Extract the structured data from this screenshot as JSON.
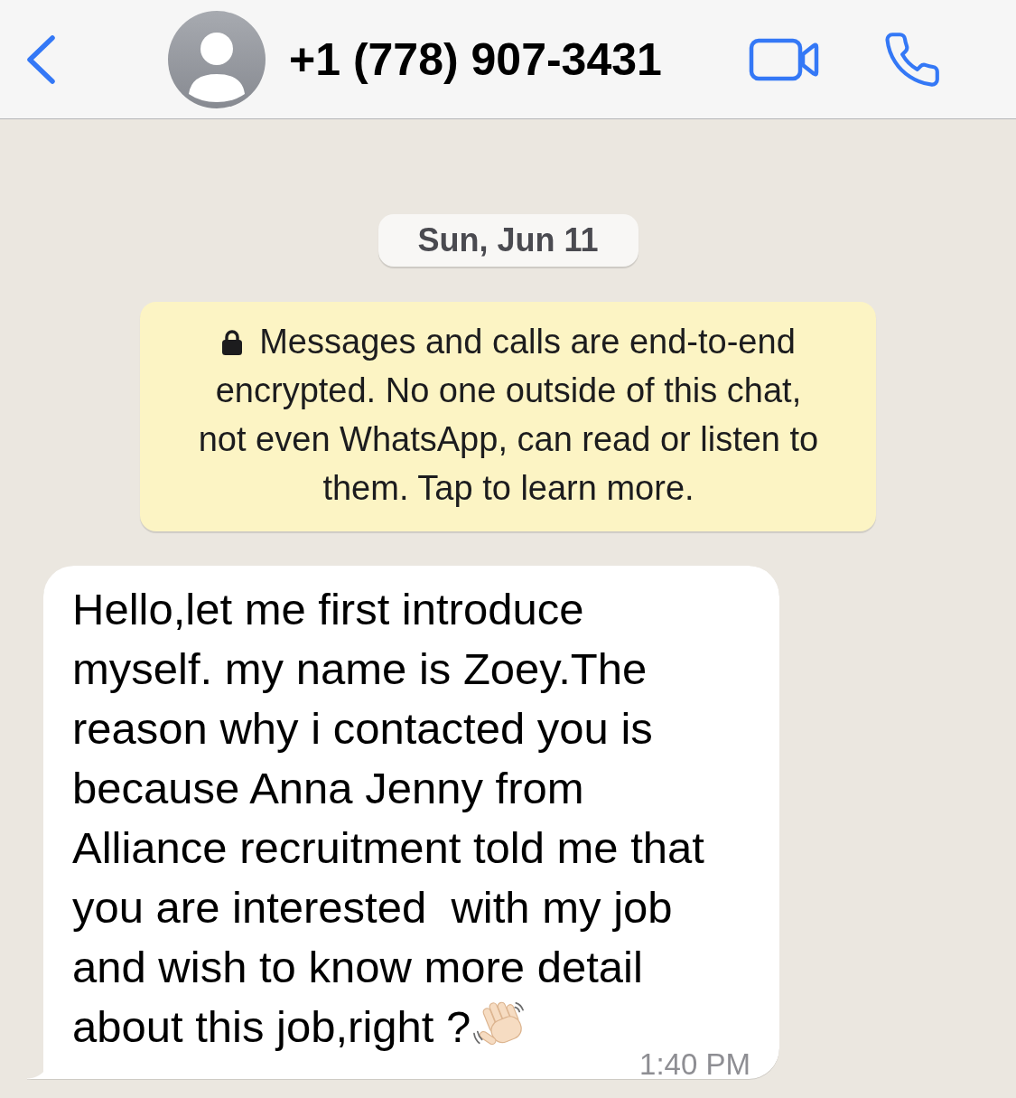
{
  "header": {
    "contact_name": "+1 (778) 907-3431"
  },
  "date_label": "Sun, Jun 11",
  "encryption_notice": {
    "text": "Messages and calls are end-to-end encrypted. No one outside of this chat, not even WhatsApp, can read or listen to them. Tap to learn more."
  },
  "messages": [
    {
      "kind": "incoming",
      "text": "Hello,let me first introduce myself. my name is Zoey.The reason why i contacted you is because Anna Jenny from Alliance recruitment told me that you are interested  with my job and wish to know more detail about this job,right ?",
      "time": "1:40 PM"
    }
  ]
}
